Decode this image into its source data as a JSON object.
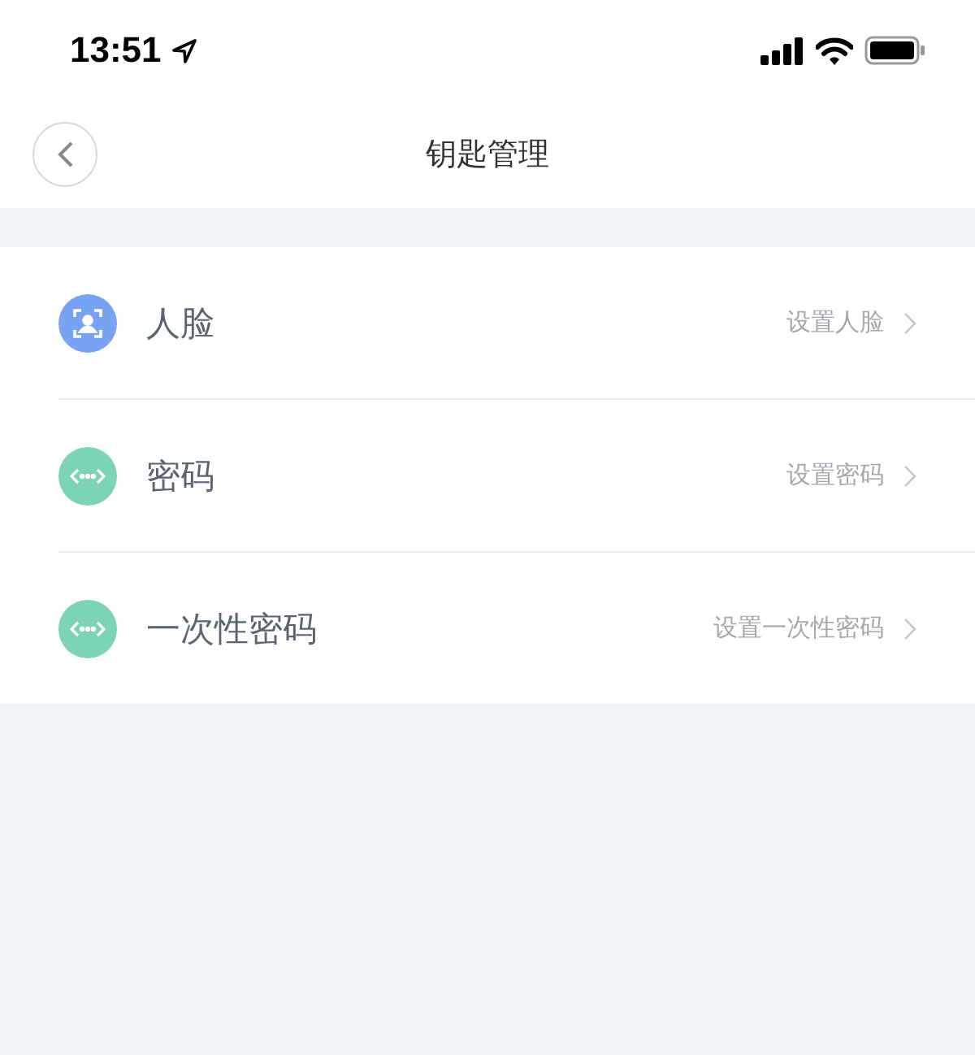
{
  "status_bar": {
    "time": "13:51"
  },
  "nav_bar": {
    "title": "钥匙管理"
  },
  "keys": [
    {
      "kind": "face",
      "color": "#78a2f2",
      "label": "人脸",
      "action": "设置人脸"
    },
    {
      "kind": "code",
      "color": "#7dd3b8",
      "label": "密码",
      "action": "设置密码"
    },
    {
      "kind": "code",
      "color": "#7dd3b8",
      "label": "一次性密码",
      "action": "设置一次性密码"
    }
  ]
}
